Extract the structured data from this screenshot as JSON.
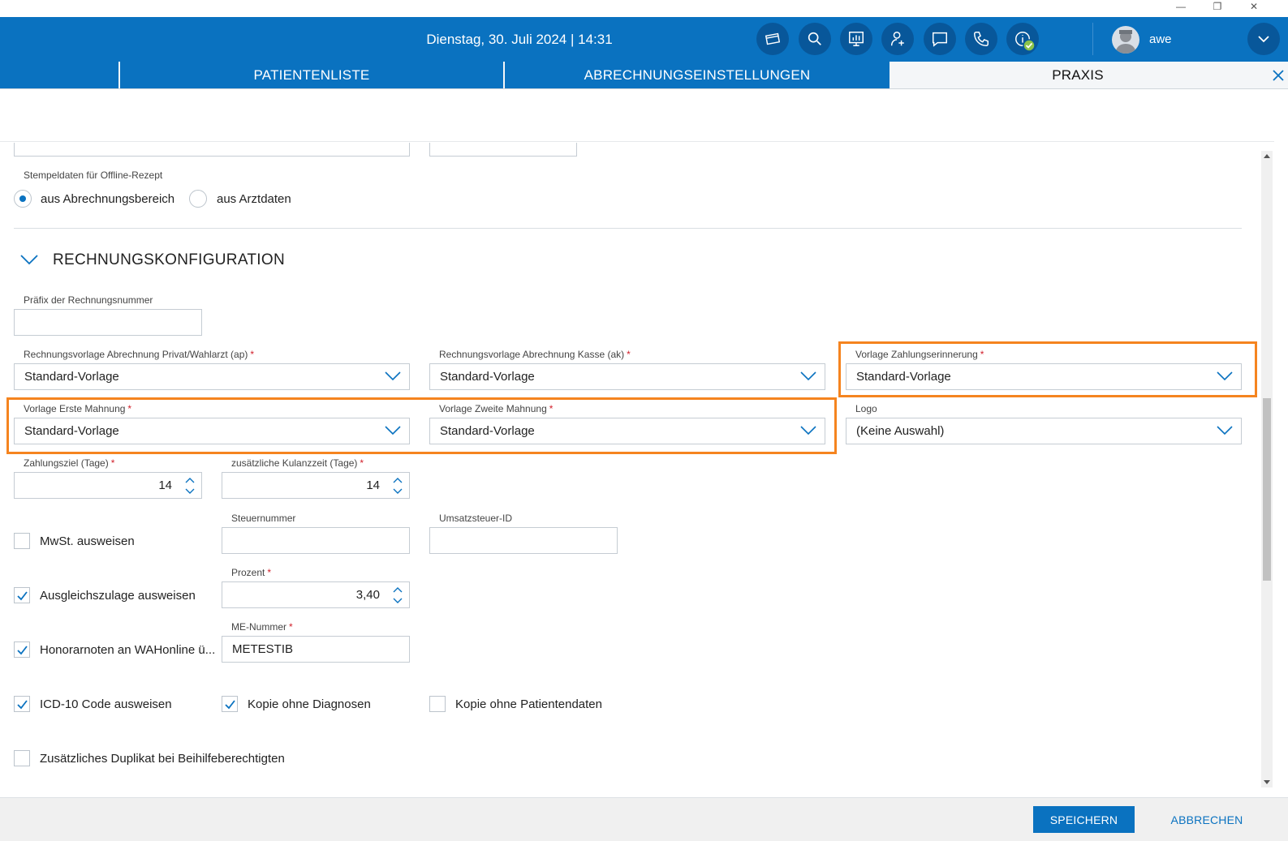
{
  "window": {
    "minimize_glyph": "—",
    "restore_glyph": "❐",
    "close_glyph": "✕"
  },
  "header": {
    "datetime": "Dienstag, 30. Juli 2024 | 14:31",
    "username": "awe",
    "icons": [
      "card-icon",
      "search-icon",
      "chart-icon",
      "add-person-icon",
      "chat-icon",
      "phone-icon",
      "info-icon",
      "chevron-down-icon"
    ],
    "accent": "#0a72c0",
    "status_ok_color": "#8bc34a"
  },
  "tabs": [
    {
      "label": "PATIENTENLISTE",
      "active": false
    },
    {
      "label": "ABRECHNUNGSEINSTELLUNGEN",
      "active": false
    },
    {
      "label": "PRAXIS",
      "active": true
    }
  ],
  "stamp": {
    "label": "Stempeldaten für Offline-Rezept",
    "options": [
      {
        "label": "aus Abrechnungsbereich",
        "selected": true
      },
      {
        "label": "aus Arztdaten",
        "selected": false
      }
    ]
  },
  "section": {
    "title": "RECHNUNGSKONFIGURATION"
  },
  "form": {
    "prefix": {
      "label": "Präfix der Rechnungsnummer",
      "value": ""
    },
    "template_private": {
      "label": "Rechnungsvorlage Abrechnung Privat/Wahlarzt (ap)",
      "required": "*",
      "value": "Standard-Vorlage"
    },
    "template_kasse": {
      "label": "Rechnungsvorlage Abrechnung Kasse (ak)",
      "required": "*",
      "value": "Standard-Vorlage"
    },
    "template_reminder": {
      "label": "Vorlage Zahlungserinnerung",
      "required": "*",
      "value": "Standard-Vorlage"
    },
    "template_first_dunning": {
      "label": "Vorlage Erste Mahnung",
      "required": "*",
      "value": "Standard-Vorlage"
    },
    "template_second_dunning": {
      "label": "Vorlage Zweite Mahnung",
      "required": "*",
      "value": "Standard-Vorlage"
    },
    "logo": {
      "label": "Logo",
      "value": "(Keine Auswahl)"
    },
    "payment_term": {
      "label": "Zahlungsziel (Tage)",
      "required": "*",
      "value": "14"
    },
    "grace_period": {
      "label": "zusätzliche Kulanzzeit (Tage)",
      "required": "*",
      "value": "14"
    },
    "tax_number": {
      "label": "Steuernummer",
      "value": ""
    },
    "vat_id": {
      "label": "Umsatzsteuer-ID",
      "value": ""
    },
    "show_vat": {
      "label": "MwSt. ausweisen",
      "checked": false
    },
    "percent": {
      "label": "Prozent",
      "required": "*",
      "value": "3,40"
    },
    "show_compensation": {
      "label": "Ausgleichszulage ausweisen",
      "checked": true
    },
    "me_number": {
      "label": "ME-Nummer",
      "required": "*",
      "value": "METESTIB"
    },
    "fee_notes": {
      "label": "Honorarnoten an WAHonline ü...",
      "checked": true
    },
    "show_icd10": {
      "label": "ICD-10 Code ausweisen",
      "checked": true
    },
    "copy_no_diagnosis": {
      "label": "Kopie ohne Diagnosen",
      "checked": true
    },
    "copy_no_patient": {
      "label": "Kopie ohne Patientendaten",
      "checked": false
    },
    "extra_duplicate": {
      "label": "Zusätzliches Duplikat bei Beihilfeberechtigten",
      "checked": false
    }
  },
  "highlight_color": "#f5841f",
  "footer": {
    "save_label": "SPEICHERN",
    "cancel_label": "ABBRECHEN"
  }
}
